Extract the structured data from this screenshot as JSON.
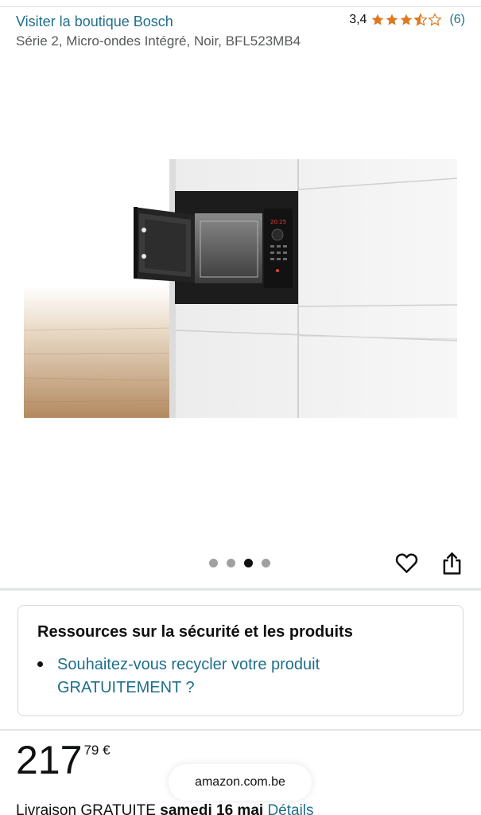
{
  "header": {
    "store_link": "Visiter la boutique Bosch",
    "rating_value": "3,4",
    "rating_stars": 3.4,
    "rating_count": "(6)",
    "product_title": "Série 2, Micro-ondes Intégré, Noir, BFL523MB4"
  },
  "gallery": {
    "image_name": "microwave-product-image",
    "current_image": 3,
    "image_count": 4
  },
  "actions": {
    "wishlist_icon": "heart-icon",
    "share_icon": "share-icon"
  },
  "safety_card": {
    "title": "Ressources sur la sécurité et les produits",
    "link": "Souhaitez-vous recycler votre produit GRATUITEMENT ?"
  },
  "price": {
    "whole": "217",
    "fraction": "79 €"
  },
  "browser": {
    "domain": "amazon.com.be"
  },
  "delivery": {
    "prefix": "Livraison GRATUITE ",
    "date": "samedi 16 mai",
    "details": "Détails"
  },
  "colors": {
    "link": "#1f6f8b",
    "star": "#de7921",
    "text": "#0f1111"
  }
}
